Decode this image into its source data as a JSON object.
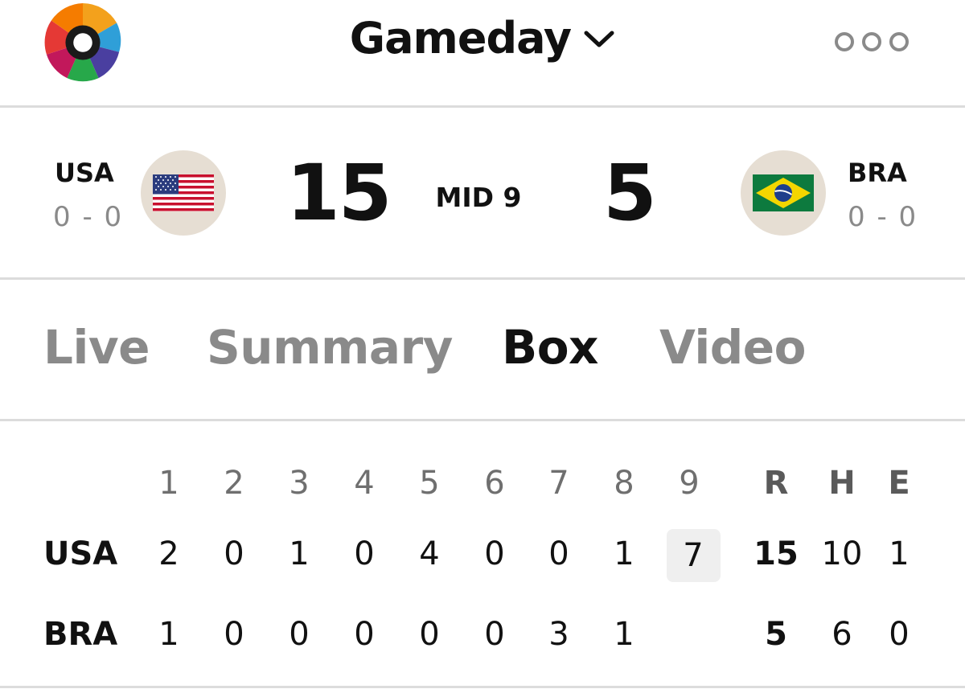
{
  "app": {
    "title": "Gameday"
  },
  "away": {
    "abbr": "USA",
    "record": "0 - 0",
    "score": "15"
  },
  "home": {
    "abbr": "BRA",
    "record": "0 - 0",
    "score": "5"
  },
  "status": "MID 9",
  "tabs": [
    {
      "label": "Live",
      "active": false
    },
    {
      "label": "Summary",
      "active": false
    },
    {
      "label": "Box",
      "active": true
    },
    {
      "label": "Video",
      "active": false
    }
  ],
  "linescore": {
    "innings": [
      "1",
      "2",
      "3",
      "4",
      "5",
      "6",
      "7",
      "8",
      "9"
    ],
    "totals_headers": [
      "R",
      "H",
      "E"
    ],
    "rows": [
      {
        "team": "USA",
        "innings": [
          "2",
          "0",
          "1",
          "0",
          "4",
          "0",
          "0",
          "1",
          "7"
        ],
        "totals": [
          "15",
          "10",
          "1"
        ]
      },
      {
        "team": "BRA",
        "innings": [
          "1",
          "0",
          "0",
          "0",
          "0",
          "0",
          "3",
          "1",
          ""
        ],
        "totals": [
          "5",
          "6",
          "0"
        ]
      }
    ],
    "current_inning": "9"
  },
  "colors": {
    "text": "#111111",
    "muted": "#8a8a8a",
    "divider": "#dcdcdc",
    "flag_bg": "#e6ded3",
    "highlight": "#efefef"
  },
  "icons": {
    "logo": "world-baseball-classic-logo",
    "chevron": "chevron-down-icon",
    "more": "more-options-icon"
  }
}
